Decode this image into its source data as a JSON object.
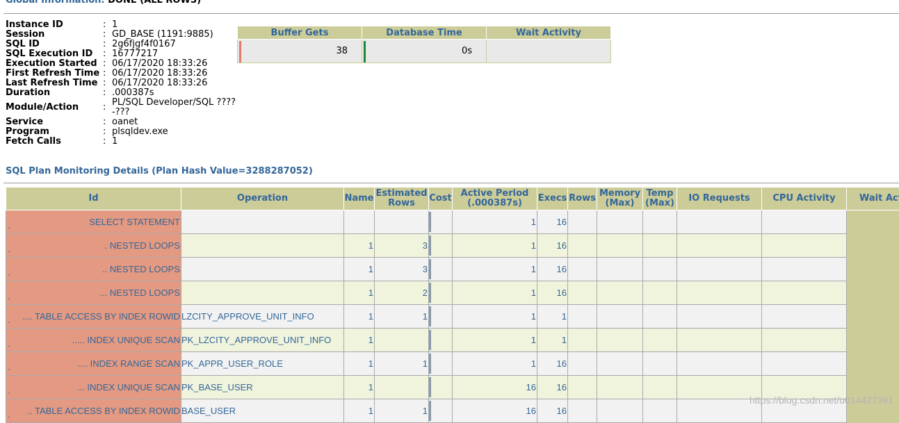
{
  "global_info": {
    "title": "Global Information:",
    "status": "DONE (ALL ROWS)",
    "fields": [
      {
        "label": "Instance ID",
        "value": "1"
      },
      {
        "label": "Session",
        "value": "GD_BASE (1191:9885)"
      },
      {
        "label": "SQL ID",
        "value": "2g6fjgf4f0167"
      },
      {
        "label": "SQL Execution ID",
        "value": "16777217"
      },
      {
        "label": "Execution Started",
        "value": "06/17/2020 18:33:26"
      },
      {
        "label": "First Refresh Time",
        "value": "06/17/2020 18:33:26"
      },
      {
        "label": "Last Refresh Time",
        "value": "06/17/2020 18:33:26"
      },
      {
        "label": "Duration",
        "value": ".000387s"
      },
      {
        "label": "Module/Action",
        "value": "PL/SQL Developer/SQL ????-???"
      },
      {
        "label": "Service",
        "value": "oanet"
      },
      {
        "label": "Program",
        "value": "plsqldev.exe"
      },
      {
        "label": "Fetch Calls",
        "value": "1"
      }
    ],
    "colon": ":"
  },
  "summary": {
    "headers": [
      "Buffer Gets",
      "Database Time",
      "Wait Activity"
    ],
    "buffer_gets": "38",
    "database_time": "0s",
    "wait_activity": "",
    "colors": {
      "buffer_gets_mark": "#e07a6a",
      "database_time_mark": "#1a8a3a"
    }
  },
  "plan": {
    "title": "SQL Plan Monitoring Details (Plan Hash Value=3288287052)",
    "headers": {
      "id": "Id",
      "operation": "Operation",
      "name": "Name",
      "estimated_rows": [
        "Estimated",
        "Rows"
      ],
      "cost": "Cost",
      "active_period": [
        "Active Period",
        "(.000387s)"
      ],
      "execs": "Execs",
      "rows": "Rows",
      "memory": [
        "Memory",
        "(Max)"
      ],
      "temp": [
        "Temp",
        "(Max)"
      ],
      "io_requests": "IO Requests",
      "cpu_activity": "CPU Activity",
      "wait_activity": "Wait Act"
    },
    "rows": [
      {
        "prefix": ".",
        "operation": "SELECT STATEMENT",
        "object": "",
        "name": "",
        "est_rows": "",
        "active": "1",
        "execs": "16"
      },
      {
        "prefix": ". .",
        "operation": "NESTED LOOPS",
        "object": "",
        "name": "1",
        "est_rows": "3",
        "active": "1",
        "execs": "16"
      },
      {
        "prefix": ". ..",
        "operation": "NESTED LOOPS",
        "object": "",
        "name": "1",
        "est_rows": "3",
        "active": "1",
        "execs": "16"
      },
      {
        "prefix": ". ...",
        "operation": "NESTED LOOPS",
        "object": "",
        "name": "1",
        "est_rows": "2",
        "active": "1",
        "execs": "16"
      },
      {
        "prefix": ". ....",
        "operation": "TABLE ACCESS BY INDEX ROWID",
        "object": "LZCITY_APPROVE_UNIT_INFO",
        "name": "1",
        "est_rows": "1",
        "active": "1",
        "execs": "1"
      },
      {
        "prefix": ". .....",
        "operation": "INDEX UNIQUE SCAN",
        "object": "PK_LZCITY_APPROVE_UNIT_INFO",
        "name": "1",
        "est_rows": "",
        "active": "1",
        "execs": "1"
      },
      {
        "prefix": ". ....",
        "operation": "INDEX RANGE SCAN",
        "object": "PK_APPR_USER_ROLE",
        "name": "1",
        "est_rows": "1",
        "active": "1",
        "execs": "16"
      },
      {
        "prefix": ". ...",
        "operation": "INDEX UNIQUE SCAN",
        "object": "PK_BASE_USER",
        "name": "1",
        "est_rows": "",
        "active": "16",
        "execs": "16"
      },
      {
        "prefix": ". ..",
        "operation": "TABLE ACCESS BY INDEX ROWID",
        "object": "BASE_USER",
        "name": "1",
        "est_rows": "1",
        "active": "16",
        "execs": "16"
      }
    ],
    "colors": {
      "id_cell": "#e49a82",
      "header_bg": "#cccc99",
      "header_text": "#336699"
    }
  },
  "watermark": "https://blog.csdn.net/u014427391"
}
